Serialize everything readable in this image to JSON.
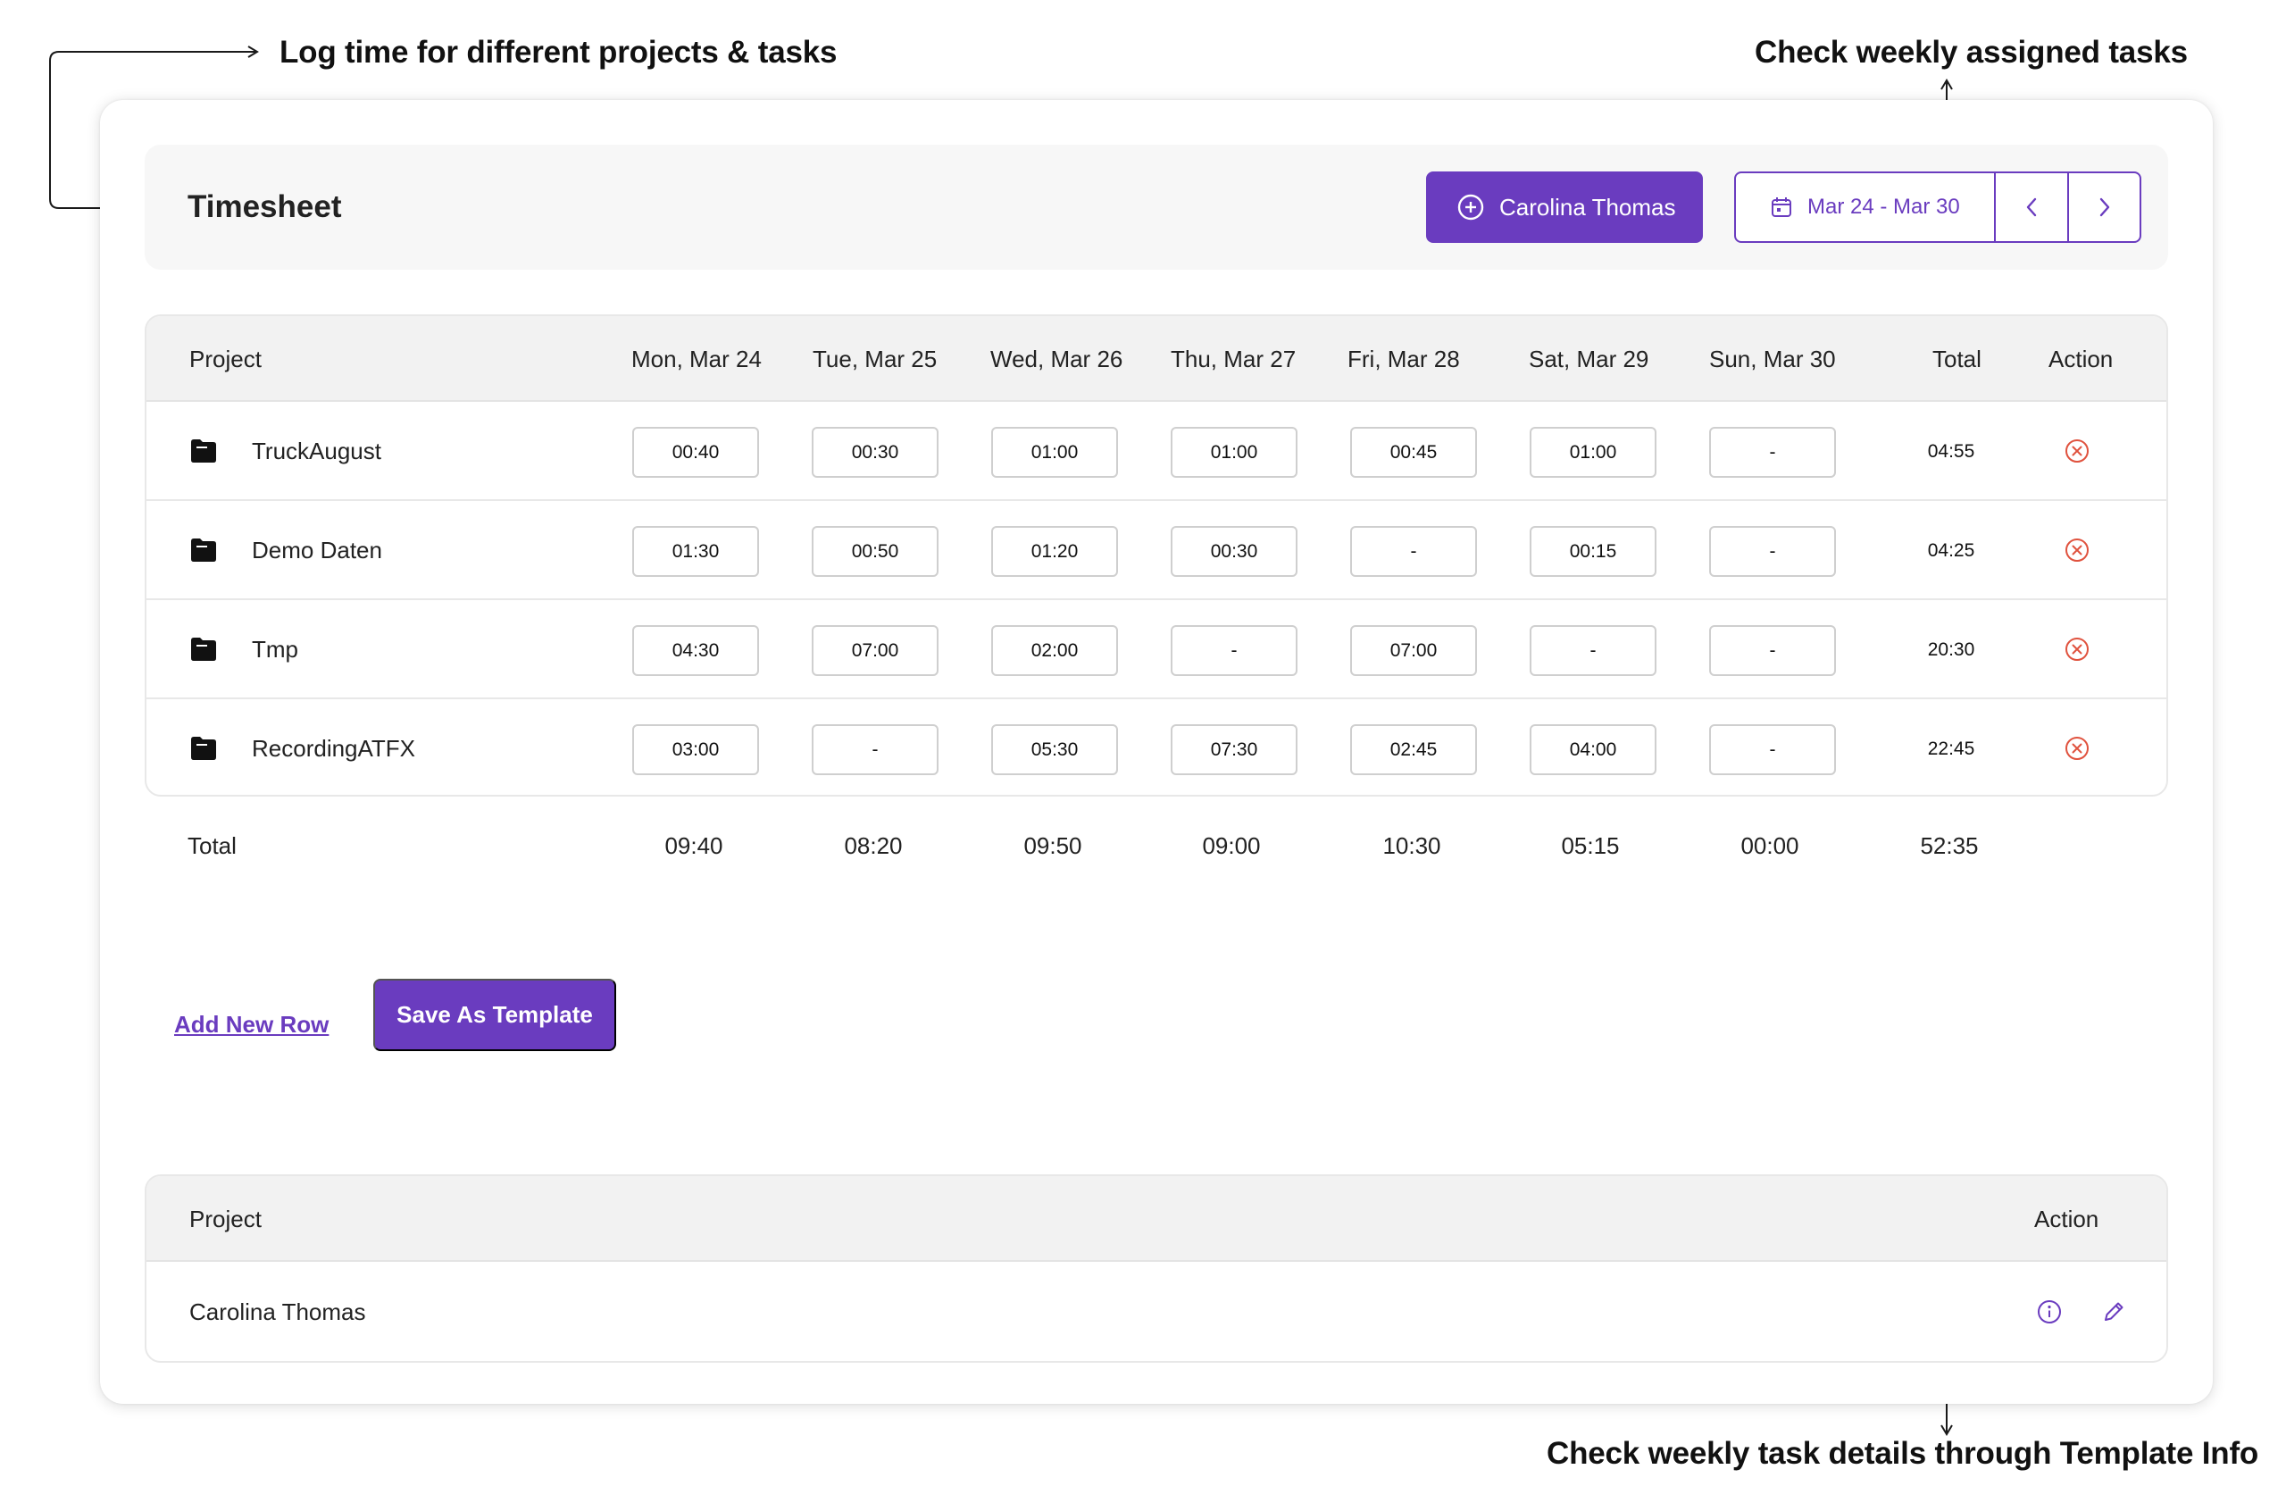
{
  "annotations": {
    "log_time": "Log time for different projects & tasks",
    "weekly_tasks": "Check weekly assigned tasks",
    "template_info": "Check weekly task details through Template Info"
  },
  "header": {
    "title": "Timesheet",
    "user_button": "Carolina Thomas",
    "date_range": "Mar 24 - Mar 30"
  },
  "colors": {
    "accent": "#6a3cbf",
    "danger": "#e0523e"
  },
  "timesheet": {
    "columns": [
      "Project",
      "Mon, Mar 24",
      "Tue, Mar 25",
      "Wed, Mar 26",
      "Thu, Mar 27",
      "Fri, Mar 28",
      "Sat, Mar 29",
      "Sun, Mar 30",
      "Total",
      "Action"
    ],
    "rows": [
      {
        "project": "TruckAugust",
        "times": [
          "00:40",
          "00:30",
          "01:00",
          "01:00",
          "00:45",
          "01:00",
          "-"
        ],
        "total": "04:55"
      },
      {
        "project": "Demo Daten",
        "times": [
          "01:30",
          "00:50",
          "01:20",
          "00:30",
          "-",
          "00:15",
          "-"
        ],
        "total": "04:25"
      },
      {
        "project": "Tmp",
        "times": [
          "04:30",
          "07:00",
          "02:00",
          "-",
          "07:00",
          "-",
          "-"
        ],
        "total": "20:30"
      },
      {
        "project": "RecordingATFX",
        "times": [
          "03:00",
          "-",
          "05:30",
          "07:30",
          "02:45",
          "04:00",
          "-"
        ],
        "total": "22:45"
      }
    ],
    "totals": {
      "label": "Total",
      "values": [
        "09:40",
        "08:20",
        "09:50",
        "09:00",
        "10:30",
        "05:15",
        "00:00",
        "52:35"
      ]
    }
  },
  "actions": {
    "add_row": "Add New Row",
    "save_template": "Save As Template"
  },
  "templates": {
    "columns": [
      "Project",
      "Action"
    ],
    "rows": [
      {
        "name": "Carolina Thomas"
      }
    ]
  }
}
